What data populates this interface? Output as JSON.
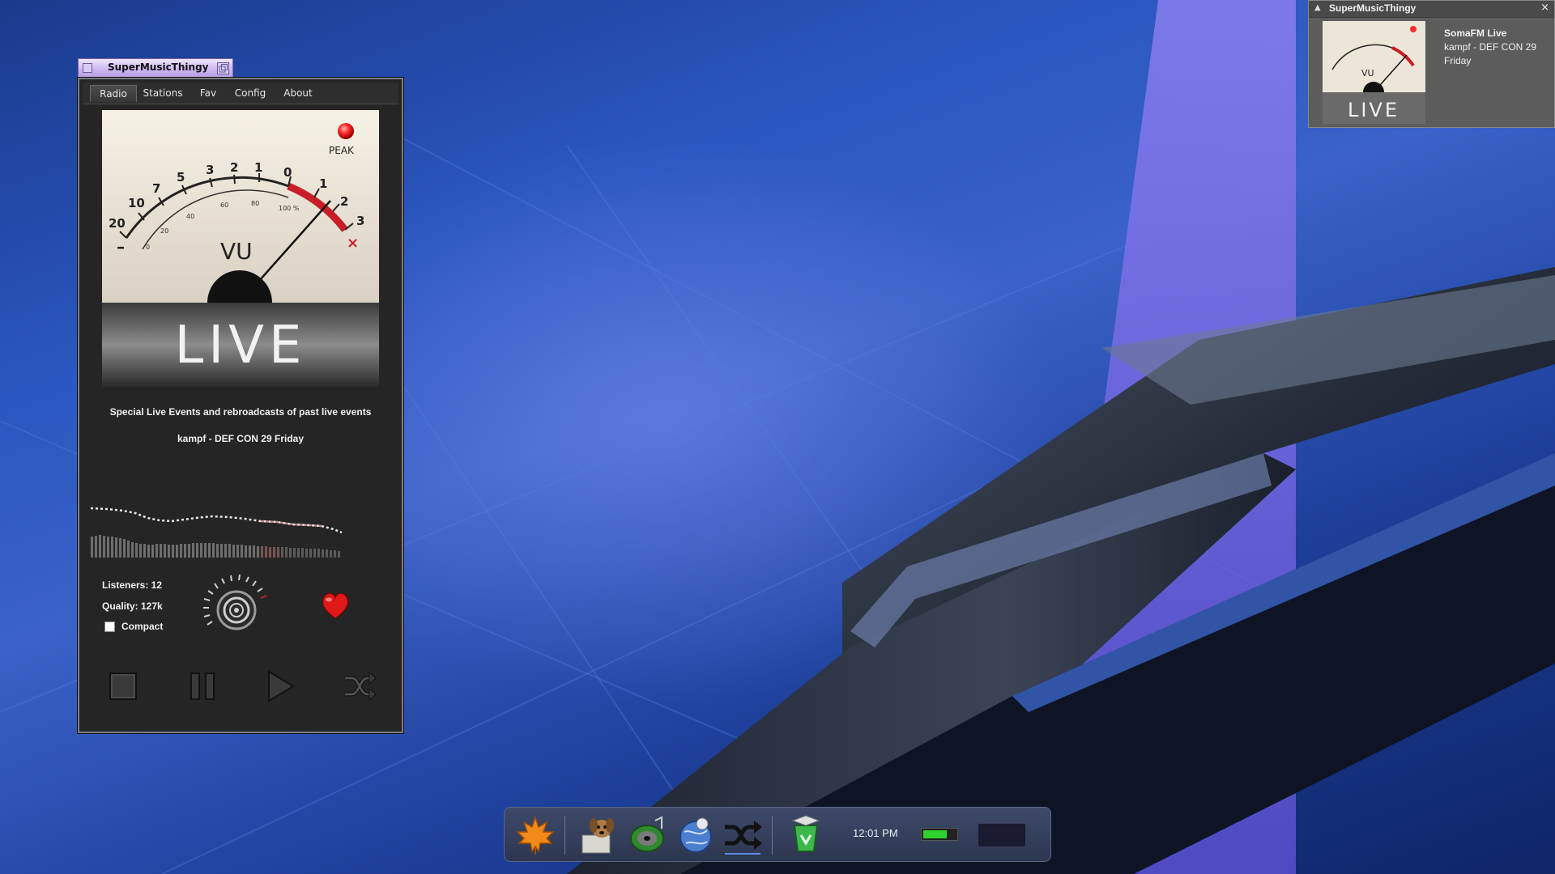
{
  "window": {
    "title": "SuperMusicThingy",
    "tabs": [
      "Radio",
      "Stations",
      "Fav",
      "Config",
      "About"
    ],
    "active_tab": "Radio"
  },
  "player": {
    "station_description": "Special Live Events and rebroadcasts of past live events",
    "track": "kampf - DEF CON 29 Friday",
    "listeners": "Listeners: 12",
    "quality": "Quality: 127k",
    "compact_label": "Compact",
    "compact_checked": false,
    "vu_meter": {
      "scale_labels": [
        "20",
        "10",
        "7",
        "5",
        "3",
        "2",
        "1",
        "0",
        "1",
        "2",
        "3"
      ],
      "percent_labels": [
        "0",
        "20",
        "40",
        "60",
        "80",
        "100 %"
      ],
      "center_label": "VU",
      "peak_label": "PEAK",
      "banner": "LIVE"
    },
    "favorite": true
  },
  "notification": {
    "app": "SuperMusicThingy",
    "station": "SomaFM Live",
    "track_line1": "kampf - DEF CON 29",
    "track_line2": "Friday",
    "close_glyph": "×",
    "collapse_glyph": "▲"
  },
  "dock": {
    "clock": "12:01 PM",
    "battery_level": 0.72,
    "icons": [
      "maple-leaf-icon",
      "dog-file-manager-icon",
      "music-disc-icon",
      "globe-browser-icon",
      "shuffle-icon",
      "recycle-bin-icon"
    ]
  },
  "colors": {
    "accent": "#c81e2a",
    "peak_led": "#ff2a2a",
    "titlebar": "#c9b3ef",
    "battery": "#2ed12e"
  }
}
